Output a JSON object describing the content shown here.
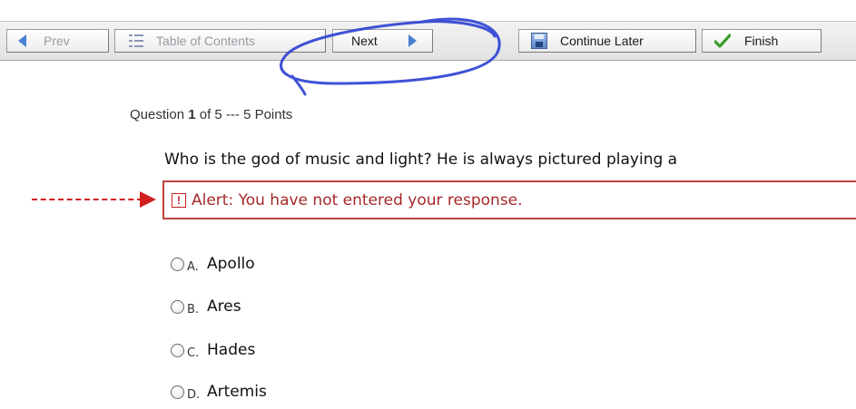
{
  "toolbar": {
    "prev_label": "Prev",
    "toc_label": "Table of Contents",
    "next_label": "Next",
    "continue_later_label": "Continue Later",
    "finish_label": "Finish"
  },
  "question": {
    "header_prefix": "Question ",
    "number": "1",
    "header_suffix": " of 5 --- 5 Points",
    "text": "Who is the god of music and light? He is always pictured playing a"
  },
  "alert": {
    "icon": "!",
    "text": "Alert: You have not entered your response."
  },
  "options": [
    {
      "letter": "A.",
      "text": "Apollo"
    },
    {
      "letter": "B.",
      "text": "Ares"
    },
    {
      "letter": "C.",
      "text": "Hades"
    },
    {
      "letter": "D.",
      "text": "Artemis"
    }
  ],
  "colors": {
    "annotation_circle": "#2a3fd1",
    "annotation_arrow": "#d22020",
    "alert_border": "#c04040",
    "alert_text": "#a52a2a",
    "nav_arrow": "#4a7fd4"
  },
  "icons": {
    "prev": "left-triangle-icon",
    "toc": "list-icon",
    "next": "right-triangle-icon",
    "continue_later": "save-icon",
    "finish": "checkmark-icon",
    "alert": "exclamation-icon"
  }
}
